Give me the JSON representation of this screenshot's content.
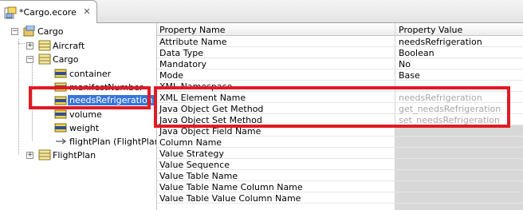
{
  "tab": {
    "title": "*Cargo.ecore",
    "icon": "ecore-file-icon",
    "close_icon": "close-icon"
  },
  "tree": {
    "root": "Cargo",
    "items": [
      {
        "label": "Aircraft",
        "icon": "class-icon"
      },
      {
        "label": "Cargo",
        "icon": "class-icon"
      },
      {
        "label": "container",
        "icon": "attribute-icon"
      },
      {
        "label": "manifestNumber",
        "icon": "attribute-icon"
      },
      {
        "label": "needsRefrigeration",
        "icon": "attribute-icon"
      },
      {
        "label": "volume",
        "icon": "attribute-icon"
      },
      {
        "label": "weight",
        "icon": "attribute-icon"
      },
      {
        "label": "flightPlan (FlightPlan)",
        "icon": "reference-icon"
      },
      {
        "label": "FlightPlan",
        "icon": "class-icon"
      }
    ]
  },
  "properties": {
    "header": {
      "name": "Property Name",
      "value": "Property Value"
    },
    "rows": [
      {
        "name": "Attribute Name",
        "value": "needsRefrigeration"
      },
      {
        "name": "Data Type",
        "value": "Boolean"
      },
      {
        "name": "Mandatory",
        "value": "No"
      },
      {
        "name": "Mode",
        "value": "Base"
      },
      {
        "name": "XML Namespace",
        "value": ""
      },
      {
        "name": "XML Element Name",
        "value": "needsRefrigeration"
      },
      {
        "name": "Java Object Get Method",
        "value": "get_needsRefrigeration"
      },
      {
        "name": "Java Object Set Method",
        "value": "set_needsRefrigeration"
      },
      {
        "name": "Java Object Field Name",
        "value": ""
      },
      {
        "name": "Column Name",
        "value": ""
      },
      {
        "name": "Value Strategy",
        "value": ""
      },
      {
        "name": "Value Sequence",
        "value": ""
      },
      {
        "name": "Value Table Name",
        "value": ""
      },
      {
        "name": "Value Table Name Column Name",
        "value": ""
      },
      {
        "name": "Value Table Value Column Name",
        "value": ""
      }
    ]
  },
  "colors": {
    "highlight": "#e01b24",
    "selection": "#3875d7"
  }
}
